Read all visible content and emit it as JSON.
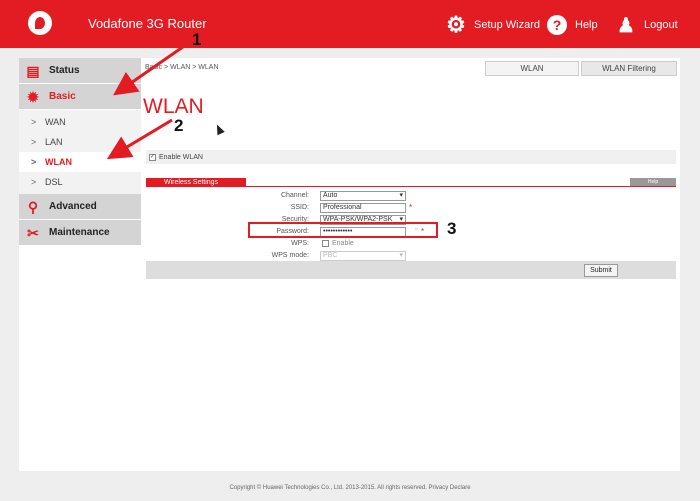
{
  "header": {
    "title": "Vodafone 3G Router",
    "setup_wizard": "Setup Wizard",
    "help": "Help",
    "logout": "Logout",
    "accent_color": "#e31b23"
  },
  "sidebar": {
    "main_items": [
      {
        "label": "Status",
        "icon": "status-icon"
      },
      {
        "label": "Basic",
        "icon": "gear-icon",
        "active": true
      },
      {
        "label": "Advanced",
        "icon": "search-icon"
      },
      {
        "label": "Maintenance",
        "icon": "tools-icon"
      }
    ],
    "sub_items": [
      {
        "label": "WAN"
      },
      {
        "label": "LAN"
      },
      {
        "label": "WLAN",
        "active": true
      },
      {
        "label": "DSL"
      }
    ]
  },
  "main": {
    "breadcrumb": "Basic > WLAN > WLAN",
    "tabs": [
      {
        "label": "WLAN",
        "active": true
      },
      {
        "label": "WLAN Filtering"
      }
    ],
    "heading": "WLAN",
    "enable_wlan_label": "Enable WLAN",
    "settings_tab": "Wireless Settings",
    "help_button": "Help",
    "form": {
      "channel_label": "Channel:",
      "channel_value": "Auto",
      "ssid_label": "SSID:",
      "ssid_value": "Professional",
      "security_label": "Security:",
      "security_value": "WPA-PSK/WPA2-PSK",
      "password_label": "Password:",
      "password_value": "••••••••••••",
      "wps_label": "WPS:",
      "wps_enable_label": "Enable",
      "wps_mode_label": "WPS mode:",
      "wps_mode_value": "PBC",
      "required_mark": "*"
    },
    "submit": "Submit"
  },
  "annotations": {
    "n1": "1",
    "n2": "2",
    "n3": "3"
  },
  "footer": "Copyright © Huawei Technologies Co., Ltd. 2013-2015. All rights reserved. Privacy Declare"
}
